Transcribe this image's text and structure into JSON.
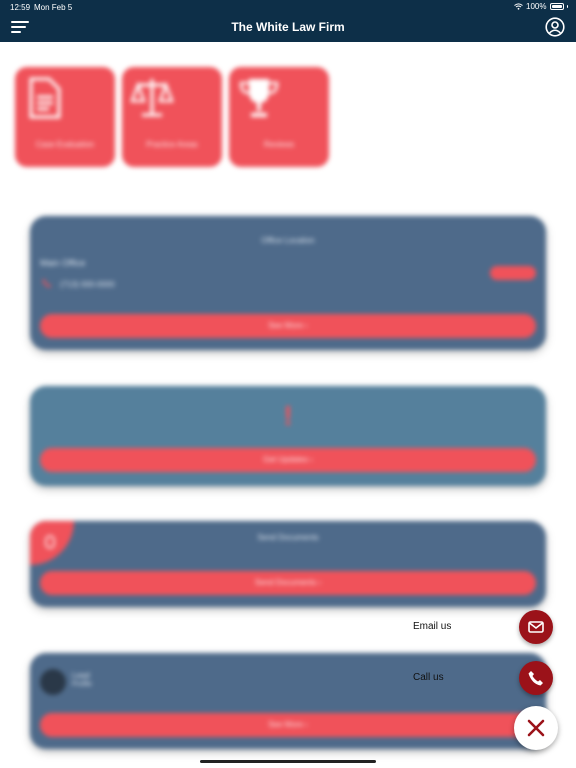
{
  "status_bar": {
    "time": "12:59",
    "date": "Mon Feb 5",
    "battery": "100%"
  },
  "header": {
    "title": "The White Law Firm"
  },
  "tiles": [
    {
      "label": "Case Evaluation",
      "icon": "document-icon"
    },
    {
      "label": "Practice Areas",
      "icon": "scales-icon"
    },
    {
      "label": "Reviews",
      "icon": "trophy-icon"
    }
  ],
  "cards": {
    "office": {
      "title": "Office Location",
      "name": "Main Office",
      "phone": "(713) 000-0000",
      "button": "See More  ›"
    },
    "updates": {
      "button": "Get Updates  ›"
    },
    "documents": {
      "title": "Send Documents",
      "button": "Send Documents  ›"
    },
    "contact": {
      "name": "Lead",
      "role": "Profile",
      "button": "See More  ›"
    }
  },
  "actions": {
    "email_label": "Email us",
    "call_label": "Call us"
  },
  "colors": {
    "header_bg": "#0d2f48",
    "accent": "#f0525a",
    "fab": "#9b1219",
    "card": "#4e6a8a"
  }
}
